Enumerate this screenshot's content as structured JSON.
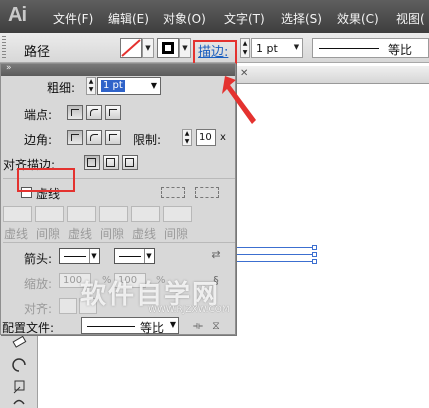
{
  "app": {
    "logo": "Ai"
  },
  "menu": [
    "文件(F)",
    "编辑(E)",
    "对象(O)",
    "文字(T)",
    "选择(S)",
    "效果(C)",
    "视图("
  ],
  "control_bar": {
    "path_label": "路径",
    "stroke_link": "描边:",
    "weight_value": "1 pt",
    "profile_label": "等比"
  },
  "panel": {
    "weight_label": "粗细:",
    "weight_value": "1 pt",
    "cap_label": "端点:",
    "corner_label": "边角:",
    "limit_label": "限制:",
    "limit_value": "10",
    "limit_unit": "x",
    "align_label": "对齐描边:",
    "dashed_label": "虚线",
    "dash_labels": [
      "虚线",
      "间隙",
      "虚线",
      "间隙",
      "虚线",
      "间隙"
    ],
    "arrow_label": "箭头:",
    "scale_label": "缩放:",
    "scale_start": "100",
    "scale_end": "100",
    "percent": "%",
    "align_arrow_label": "对齐:",
    "profile_label": "配置文件:",
    "profile_value": "等比"
  },
  "watermark": {
    "text": "软件自学网",
    "url": "WWW.RJZXW.COM"
  },
  "colors": {
    "highlight": "#e4322f",
    "link": "#1b5fbf",
    "selection": "#3c6fd0"
  }
}
